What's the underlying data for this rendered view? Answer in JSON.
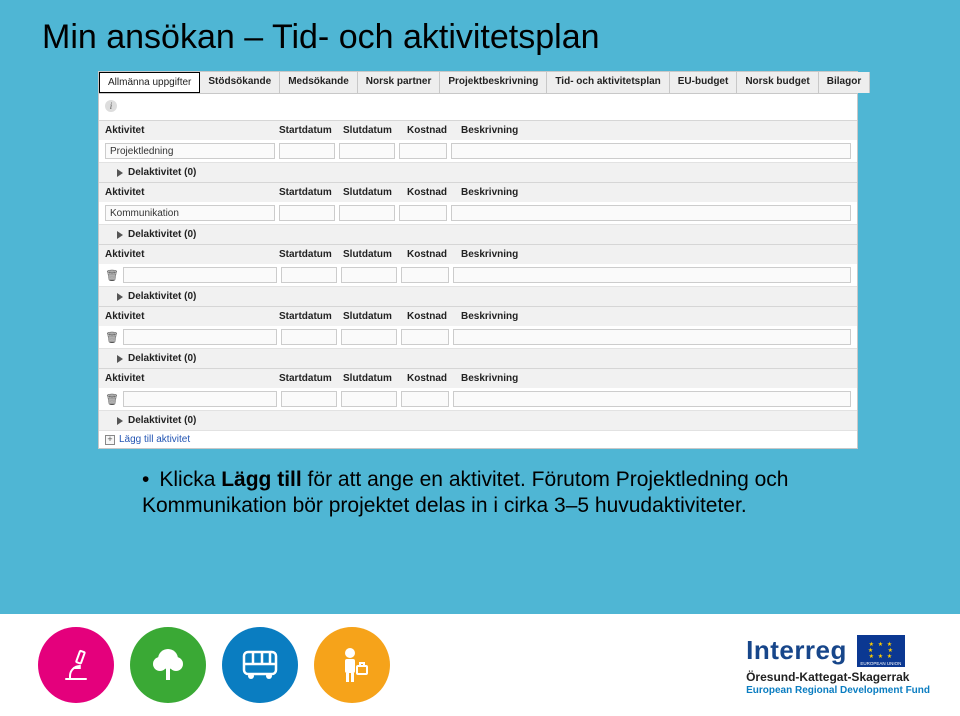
{
  "title": "Min ansökan – Tid- och aktivitetsplan",
  "tabs": [
    "Allmänna uppgifter",
    "Stödsökande",
    "Medsökande",
    "Norsk partner",
    "Projektbeskrivning",
    "Tid- och aktivitetsplan",
    "EU-budget",
    "Norsk budget",
    "Bilagor"
  ],
  "cols": {
    "act": "Aktivitet",
    "sd": "Startdatum",
    "ed": "Slutdatum",
    "kost": "Kostnad",
    "desc": "Beskrivning"
  },
  "rows": [
    {
      "name": "Projektledning"
    },
    {
      "name": "Kommunikation"
    },
    {
      "name": ""
    },
    {
      "name": ""
    },
    {
      "name": ""
    }
  ],
  "sub_label": "Delaktivitet (0)",
  "add_label": "Lägg till aktivitet",
  "bullet": {
    "prefix": "Klicka ",
    "bold": "Lägg till",
    "rest": " för att ange en aktivitet. Förutom Projektledning och Kommunikation bör projektet delas in i cirka 3–5 huvudaktiviteter."
  },
  "logo": {
    "brand": "Interreg",
    "sub1": "Öresund-Kattegat-Skagerrak",
    "sub2": "European Regional Development Fund",
    "eu": "EUROPEAN UNION"
  },
  "icons": {
    "microscope": "microscope-icon",
    "tree": "tree-icon",
    "bus": "bus-icon",
    "person": "person-briefcase-icon"
  }
}
